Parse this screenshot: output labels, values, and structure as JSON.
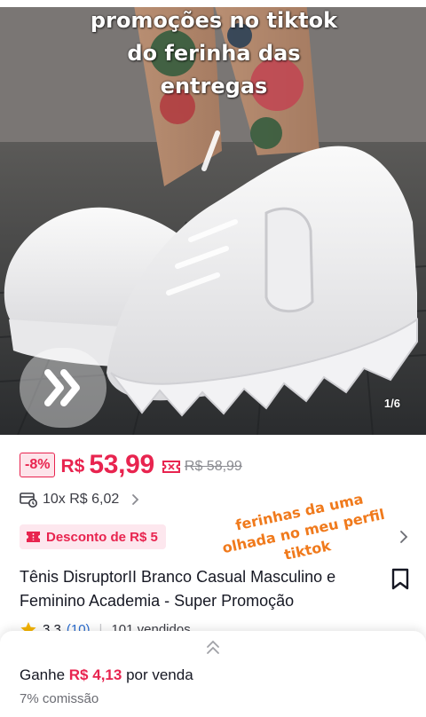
{
  "hero": {
    "overlay_lines": [
      "promoções no tiktok",
      "do ferinha das",
      "entregas"
    ],
    "image_counter": "1/6",
    "next_icon": "double-chevron-right-icon"
  },
  "price": {
    "discount": "-8%",
    "currency": "R$",
    "current": "53,99",
    "original": "R$ 58,99",
    "accent_color": "#e8244f"
  },
  "installment": {
    "text": "10x R$ 6,02"
  },
  "coupon": {
    "label": "Desconto de R$ 5"
  },
  "annotation": {
    "lines": [
      "ferinhas da uma",
      "olhada no meu perfil",
      "tiktok"
    ],
    "color": "#f07a1c"
  },
  "product": {
    "title": "Tênis DisruptorII Branco Casual Masculino e Feminino Academia - Super Promoção",
    "rating": "3.3",
    "reviews": "(10)",
    "sold": "101 vendidos"
  },
  "affiliate": {
    "earn_prefix": "Ganhe",
    "earn_amount": "R$ 4,13",
    "earn_suffix": "por venda",
    "commission": "7% comissão"
  }
}
